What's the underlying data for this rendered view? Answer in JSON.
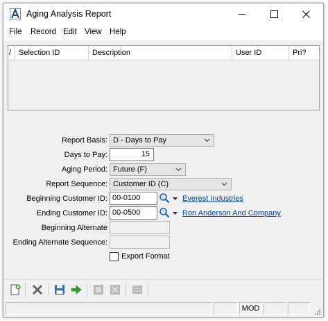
{
  "window": {
    "title": "Aging Analysis Report"
  },
  "menu": [
    "File",
    "Record",
    "Edit",
    "View",
    "Help"
  ],
  "grid": {
    "columns": [
      "/",
      "Selection ID",
      "Description",
      "User ID",
      "Pri?"
    ]
  },
  "form": {
    "report_basis": {
      "label": "Report Basis:",
      "value": "D - Days to Pay"
    },
    "days_to_pay": {
      "label": "Days to Pay:",
      "value": "15"
    },
    "aging_period": {
      "label": "Aging Period:",
      "value": "Future (F)"
    },
    "report_sequence": {
      "label": "Report Sequence:",
      "value": "Customer ID (C)"
    },
    "beginning_customer": {
      "label": "Beginning Customer ID:",
      "value": "00-0100",
      "name": "Everest Industries"
    },
    "ending_customer": {
      "label": "Ending Customer ID:",
      "value": "00-0500",
      "name": "Ron Anderson And Company"
    },
    "beginning_alternate": {
      "label": "Beginning Alternate",
      "value": ""
    },
    "ending_alternate": {
      "label": "Ending Alternate Sequence:",
      "value": ""
    },
    "export_format": {
      "label": "Export Format",
      "checked": false
    }
  },
  "toolbar": {
    "icons": [
      "new-icon",
      "delete-icon",
      "save-icon",
      "run-icon",
      "print-icon",
      "close-icon",
      "list-icon"
    ]
  },
  "status": {
    "mode": "MOD"
  },
  "colors": {
    "link": "#0645ad",
    "accent": "#1f5faf"
  }
}
